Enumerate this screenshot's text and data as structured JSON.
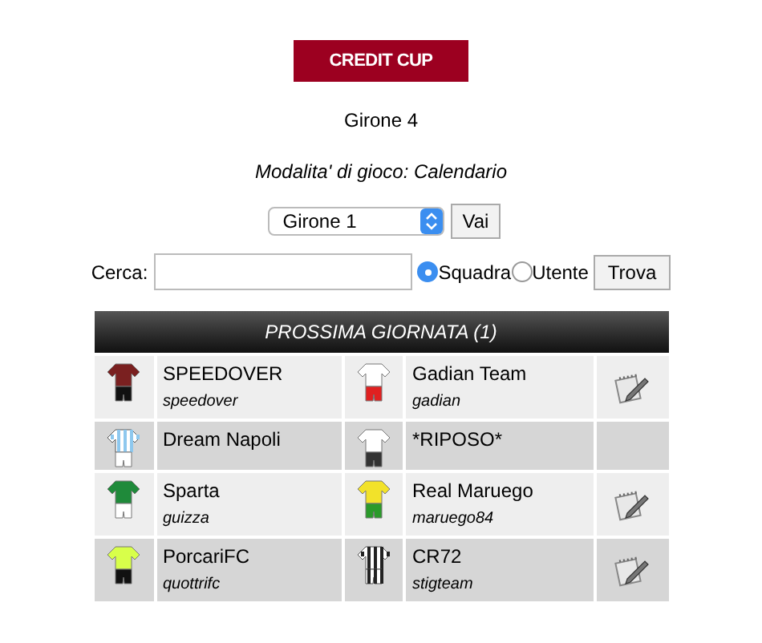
{
  "logo": "CREDIT CUP",
  "title": "Girone 4",
  "mode": "Modalita' di gioco: Calendario",
  "group_select": {
    "value": "Girone 1",
    "button": "Vai"
  },
  "search": {
    "label": "Cerca:",
    "options": [
      {
        "label": "Squadra",
        "selected": true
      },
      {
        "label": "Utente",
        "selected": false
      }
    ],
    "button": "Trova"
  },
  "fixtures": {
    "title": "PROSSIMA GIORNATA (1)",
    "rows": [
      {
        "home": {
          "team": "SPEEDOVER",
          "user": "speedover",
          "kit": [
            {
              "kind": "plain",
              "color": "#7a2020"
            },
            {
              "kind": "plain",
              "color": "#111111"
            }
          ]
        },
        "away": {
          "team": "Gadian Team",
          "user": "gadian",
          "kit": [
            {
              "kind": "plain",
              "color": "#ffffff"
            },
            {
              "kind": "plain",
              "color": "#e02020"
            }
          ]
        },
        "editable": true
      },
      {
        "home": {
          "team": "Dream Napoli",
          "kit": [
            {
              "kind": "striped",
              "color": "#8ec8ee"
            },
            {
              "kind": "plain",
              "color": "#ffffff"
            }
          ]
        },
        "away": {
          "team": "*RIPOSO*",
          "kit": [
            {
              "kind": "plain",
              "color": "#ffffff"
            },
            {
              "kind": "plain",
              "color": "#333333"
            }
          ]
        },
        "editable": false
      },
      {
        "home": {
          "team": "Sparta",
          "user": "guizza",
          "kit": [
            {
              "kind": "plain",
              "color": "#1f8a3a"
            },
            {
              "kind": "plain",
              "color": "#ffffff"
            }
          ]
        },
        "away": {
          "team": "Real Maruego",
          "user": "maruego84",
          "kit": [
            {
              "kind": "plain",
              "color": "#f2e22a"
            },
            {
              "kind": "plain",
              "color": "#2a9a2a"
            }
          ]
        },
        "editable": true
      },
      {
        "home": {
          "team": "PorcariFC",
          "user": "quottrifc",
          "kit": [
            {
              "kind": "plain",
              "color": "#d8ff4a"
            },
            {
              "kind": "plain",
              "color": "#111111"
            }
          ]
        },
        "away": {
          "team": "CR72",
          "user": "stigteam",
          "kit": [
            {
              "kind": "striped",
              "color": "#222222"
            },
            {
              "kind": "striped",
              "color": "#222222"
            }
          ]
        },
        "editable": true
      }
    ]
  }
}
